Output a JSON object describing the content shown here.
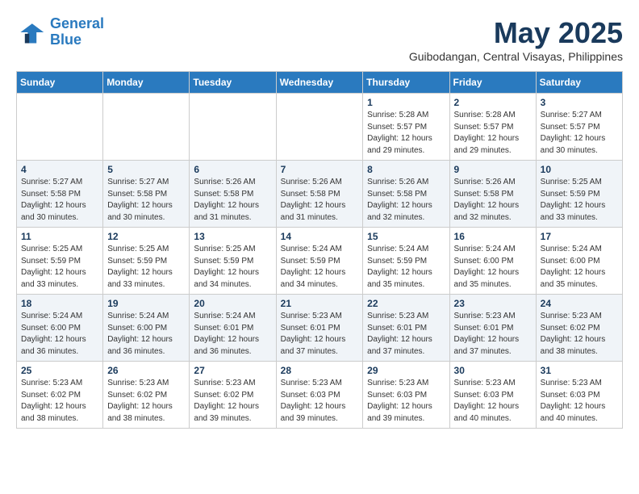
{
  "logo": {
    "line1": "General",
    "line2": "Blue"
  },
  "title": "May 2025",
  "location": "Guibodangan, Central Visayas, Philippines",
  "weekdays": [
    "Sunday",
    "Monday",
    "Tuesday",
    "Wednesday",
    "Thursday",
    "Friday",
    "Saturday"
  ],
  "weeks": [
    [
      {
        "day": "",
        "info": ""
      },
      {
        "day": "",
        "info": ""
      },
      {
        "day": "",
        "info": ""
      },
      {
        "day": "",
        "info": ""
      },
      {
        "day": "1",
        "info": "Sunrise: 5:28 AM\nSunset: 5:57 PM\nDaylight: 12 hours\nand 29 minutes."
      },
      {
        "day": "2",
        "info": "Sunrise: 5:28 AM\nSunset: 5:57 PM\nDaylight: 12 hours\nand 29 minutes."
      },
      {
        "day": "3",
        "info": "Sunrise: 5:27 AM\nSunset: 5:57 PM\nDaylight: 12 hours\nand 30 minutes."
      }
    ],
    [
      {
        "day": "4",
        "info": "Sunrise: 5:27 AM\nSunset: 5:58 PM\nDaylight: 12 hours\nand 30 minutes."
      },
      {
        "day": "5",
        "info": "Sunrise: 5:27 AM\nSunset: 5:58 PM\nDaylight: 12 hours\nand 30 minutes."
      },
      {
        "day": "6",
        "info": "Sunrise: 5:26 AM\nSunset: 5:58 PM\nDaylight: 12 hours\nand 31 minutes."
      },
      {
        "day": "7",
        "info": "Sunrise: 5:26 AM\nSunset: 5:58 PM\nDaylight: 12 hours\nand 31 minutes."
      },
      {
        "day": "8",
        "info": "Sunrise: 5:26 AM\nSunset: 5:58 PM\nDaylight: 12 hours\nand 32 minutes."
      },
      {
        "day": "9",
        "info": "Sunrise: 5:26 AM\nSunset: 5:58 PM\nDaylight: 12 hours\nand 32 minutes."
      },
      {
        "day": "10",
        "info": "Sunrise: 5:25 AM\nSunset: 5:59 PM\nDaylight: 12 hours\nand 33 minutes."
      }
    ],
    [
      {
        "day": "11",
        "info": "Sunrise: 5:25 AM\nSunset: 5:59 PM\nDaylight: 12 hours\nand 33 minutes."
      },
      {
        "day": "12",
        "info": "Sunrise: 5:25 AM\nSunset: 5:59 PM\nDaylight: 12 hours\nand 33 minutes."
      },
      {
        "day": "13",
        "info": "Sunrise: 5:25 AM\nSunset: 5:59 PM\nDaylight: 12 hours\nand 34 minutes."
      },
      {
        "day": "14",
        "info": "Sunrise: 5:24 AM\nSunset: 5:59 PM\nDaylight: 12 hours\nand 34 minutes."
      },
      {
        "day": "15",
        "info": "Sunrise: 5:24 AM\nSunset: 5:59 PM\nDaylight: 12 hours\nand 35 minutes."
      },
      {
        "day": "16",
        "info": "Sunrise: 5:24 AM\nSunset: 6:00 PM\nDaylight: 12 hours\nand 35 minutes."
      },
      {
        "day": "17",
        "info": "Sunrise: 5:24 AM\nSunset: 6:00 PM\nDaylight: 12 hours\nand 35 minutes."
      }
    ],
    [
      {
        "day": "18",
        "info": "Sunrise: 5:24 AM\nSunset: 6:00 PM\nDaylight: 12 hours\nand 36 minutes."
      },
      {
        "day": "19",
        "info": "Sunrise: 5:24 AM\nSunset: 6:00 PM\nDaylight: 12 hours\nand 36 minutes."
      },
      {
        "day": "20",
        "info": "Sunrise: 5:24 AM\nSunset: 6:01 PM\nDaylight: 12 hours\nand 36 minutes."
      },
      {
        "day": "21",
        "info": "Sunrise: 5:23 AM\nSunset: 6:01 PM\nDaylight: 12 hours\nand 37 minutes."
      },
      {
        "day": "22",
        "info": "Sunrise: 5:23 AM\nSunset: 6:01 PM\nDaylight: 12 hours\nand 37 minutes."
      },
      {
        "day": "23",
        "info": "Sunrise: 5:23 AM\nSunset: 6:01 PM\nDaylight: 12 hours\nand 37 minutes."
      },
      {
        "day": "24",
        "info": "Sunrise: 5:23 AM\nSunset: 6:02 PM\nDaylight: 12 hours\nand 38 minutes."
      }
    ],
    [
      {
        "day": "25",
        "info": "Sunrise: 5:23 AM\nSunset: 6:02 PM\nDaylight: 12 hours\nand 38 minutes."
      },
      {
        "day": "26",
        "info": "Sunrise: 5:23 AM\nSunset: 6:02 PM\nDaylight: 12 hours\nand 38 minutes."
      },
      {
        "day": "27",
        "info": "Sunrise: 5:23 AM\nSunset: 6:02 PM\nDaylight: 12 hours\nand 39 minutes."
      },
      {
        "day": "28",
        "info": "Sunrise: 5:23 AM\nSunset: 6:03 PM\nDaylight: 12 hours\nand 39 minutes."
      },
      {
        "day": "29",
        "info": "Sunrise: 5:23 AM\nSunset: 6:03 PM\nDaylight: 12 hours\nand 39 minutes."
      },
      {
        "day": "30",
        "info": "Sunrise: 5:23 AM\nSunset: 6:03 PM\nDaylight: 12 hours\nand 40 minutes."
      },
      {
        "day": "31",
        "info": "Sunrise: 5:23 AM\nSunset: 6:03 PM\nDaylight: 12 hours\nand 40 minutes."
      }
    ]
  ]
}
